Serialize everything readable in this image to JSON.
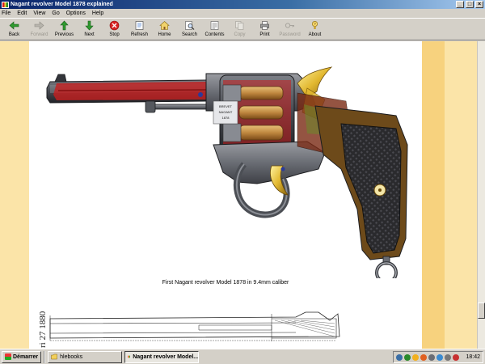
{
  "window": {
    "title": "Nagant revolver Model 1878 explained",
    "caption_buttons": [
      "_",
      "□",
      "×"
    ]
  },
  "menu": [
    "File",
    "Edit",
    "View",
    "Go",
    "Options",
    "Help"
  ],
  "toolbar": [
    {
      "label": "Back",
      "icon": "back-arrow-icon",
      "enabled": true
    },
    {
      "label": "Forward",
      "icon": "forward-arrow-icon",
      "enabled": false
    },
    {
      "label": "Previous",
      "icon": "up-arrow-icon",
      "enabled": true
    },
    {
      "label": "Next",
      "icon": "down-arrow-icon",
      "enabled": true
    },
    {
      "label": "Stop",
      "icon": "stop-icon",
      "enabled": true
    },
    {
      "label": "Refresh",
      "icon": "refresh-icon",
      "enabled": true
    },
    {
      "label": "Home",
      "icon": "home-icon",
      "enabled": true
    },
    {
      "label": "Search",
      "icon": "search-icon",
      "enabled": true
    },
    {
      "label": "Contents",
      "icon": "contents-icon",
      "enabled": true
    },
    {
      "label": "Copy",
      "icon": "copy-icon",
      "enabled": false
    },
    {
      "label": "Print",
      "icon": "print-icon",
      "enabled": true
    },
    {
      "label": "Password",
      "icon": "key-icon",
      "enabled": false
    },
    {
      "label": "About",
      "icon": "about-icon",
      "enabled": true
    }
  ],
  "content": {
    "caption": "First Nagant revolver Model 1878 in 9.4mm caliber",
    "frame_stamp": [
      "BREVET",
      "NAGANT",
      "1878"
    ],
    "drawing_label": "ri 27 1880"
  },
  "colors": {
    "margin": "#fbe4a8",
    "margin_dark": "#f7d27e",
    "titlebar": "#0a246a"
  },
  "taskbar": {
    "start_label": "Démarrer",
    "tasks": [
      {
        "label": "hlebooks",
        "active": false
      },
      {
        "label": "Nagant revolver Model...",
        "active": true
      }
    ],
    "clock": "18:42"
  }
}
